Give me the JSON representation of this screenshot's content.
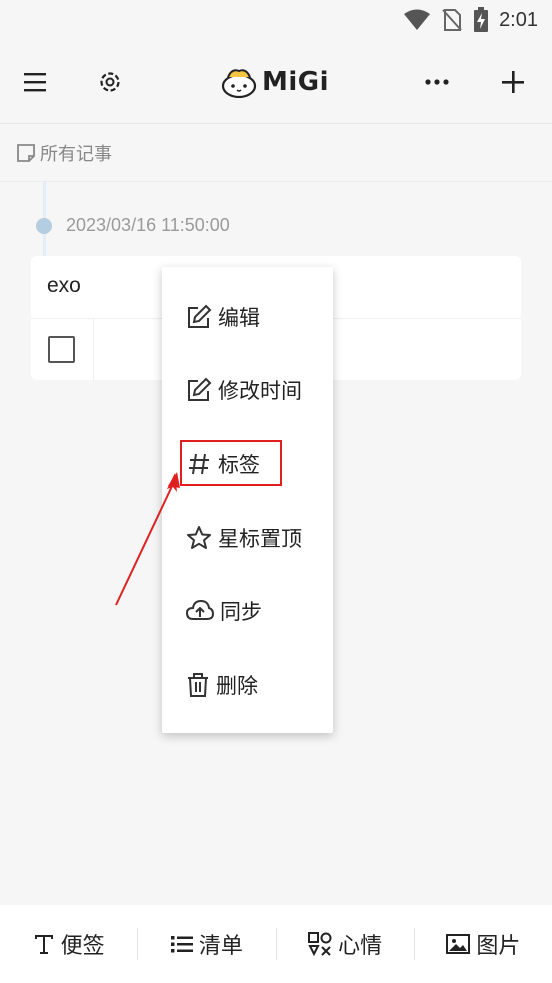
{
  "status_bar": {
    "time": "2:01",
    "icons": [
      "wifi-icon",
      "no-sim-icon",
      "battery-charging-icon"
    ]
  },
  "app_bar": {
    "logo_text": "MiGi",
    "icons": [
      "menu-icon",
      "settings-icon",
      "more-icon",
      "add-icon"
    ]
  },
  "breadcrumb": {
    "label": "所有记事",
    "icon": "note-icon"
  },
  "notes": [
    {
      "timestamp": "2023/03/16 11:50:00",
      "title": "exo",
      "checked": false
    }
  ],
  "context_menu": {
    "items": [
      {
        "label": "编辑",
        "icon": "edit-icon"
      },
      {
        "label": "修改时间",
        "icon": "edit-time-icon"
      },
      {
        "label": "标签",
        "icon": "hashtag-icon",
        "highlighted": true
      },
      {
        "label": "星标置顶",
        "icon": "star-icon"
      },
      {
        "label": "同步",
        "icon": "cloud-upload-icon"
      },
      {
        "label": "删除",
        "icon": "trash-icon"
      }
    ]
  },
  "bottom_toolbar": {
    "items": [
      {
        "label": "便签",
        "icon": "text-icon"
      },
      {
        "label": "清单",
        "icon": "list-icon"
      },
      {
        "label": "心情",
        "icon": "mood-icon"
      },
      {
        "label": "图片",
        "icon": "image-icon"
      }
    ]
  },
  "colors": {
    "highlight": "#e02020",
    "timeline_dot": "#b5cde0",
    "background": "#f6f6f7"
  }
}
